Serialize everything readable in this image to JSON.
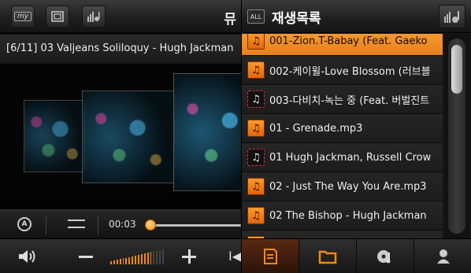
{
  "player": {
    "top_bar": {
      "my_label": "my",
      "title_fragment": "뮤"
    },
    "now_playing": "[6/11] 03 Valjeans Soliloquy - Hugh Jackman",
    "elapsed": "00:03",
    "progress": 0.02,
    "volume_level": 0.8,
    "colors": {
      "accent": "#f28a12"
    }
  },
  "playlist": {
    "all_label": "ALL",
    "title": "재생목록",
    "items": [
      {
        "label": "001-Zion.T-Babay (Feat. Gaeko",
        "icon": "music-note-icon",
        "style": "filled",
        "active": true
      },
      {
        "label": "002-케이윌-Love Blossom (러브블",
        "icon": "music-note-icon",
        "style": "filled",
        "active": false
      },
      {
        "label": "003-다비치-녹는 중 (Feat. 버벌진트",
        "icon": "music-note-icon",
        "style": "outlined",
        "active": false
      },
      {
        "label": "01 - Grenade.mp3",
        "icon": "music-note-icon",
        "style": "filled",
        "active": false
      },
      {
        "label": "01 Hugh Jackman, Russell Crow",
        "icon": "music-note-icon",
        "style": "outlined",
        "active": false
      },
      {
        "label": "02 - Just The Way You Are.mp3",
        "icon": "music-note-icon",
        "style": "filled",
        "active": false
      },
      {
        "label": "02 The Bishop - Hugh Jackman",
        "icon": "music-note-icon",
        "style": "filled",
        "active": false
      },
      {
        "label": "",
        "icon": "music-note-icon",
        "style": "filled",
        "active": false
      }
    ]
  },
  "icons": {
    "my": "my-icon",
    "window": "window-icon",
    "eq": "equalizer-icon",
    "repeat": "repeat-icon",
    "shuffle": "shuffle-icon",
    "volume": "volume-icon",
    "minus": "minus-icon",
    "plus": "plus-icon",
    "prev": "previous-track-icon",
    "list": "playlist-icon",
    "folder": "folder-icon",
    "album": "album-icon",
    "artist": "artist-icon"
  }
}
